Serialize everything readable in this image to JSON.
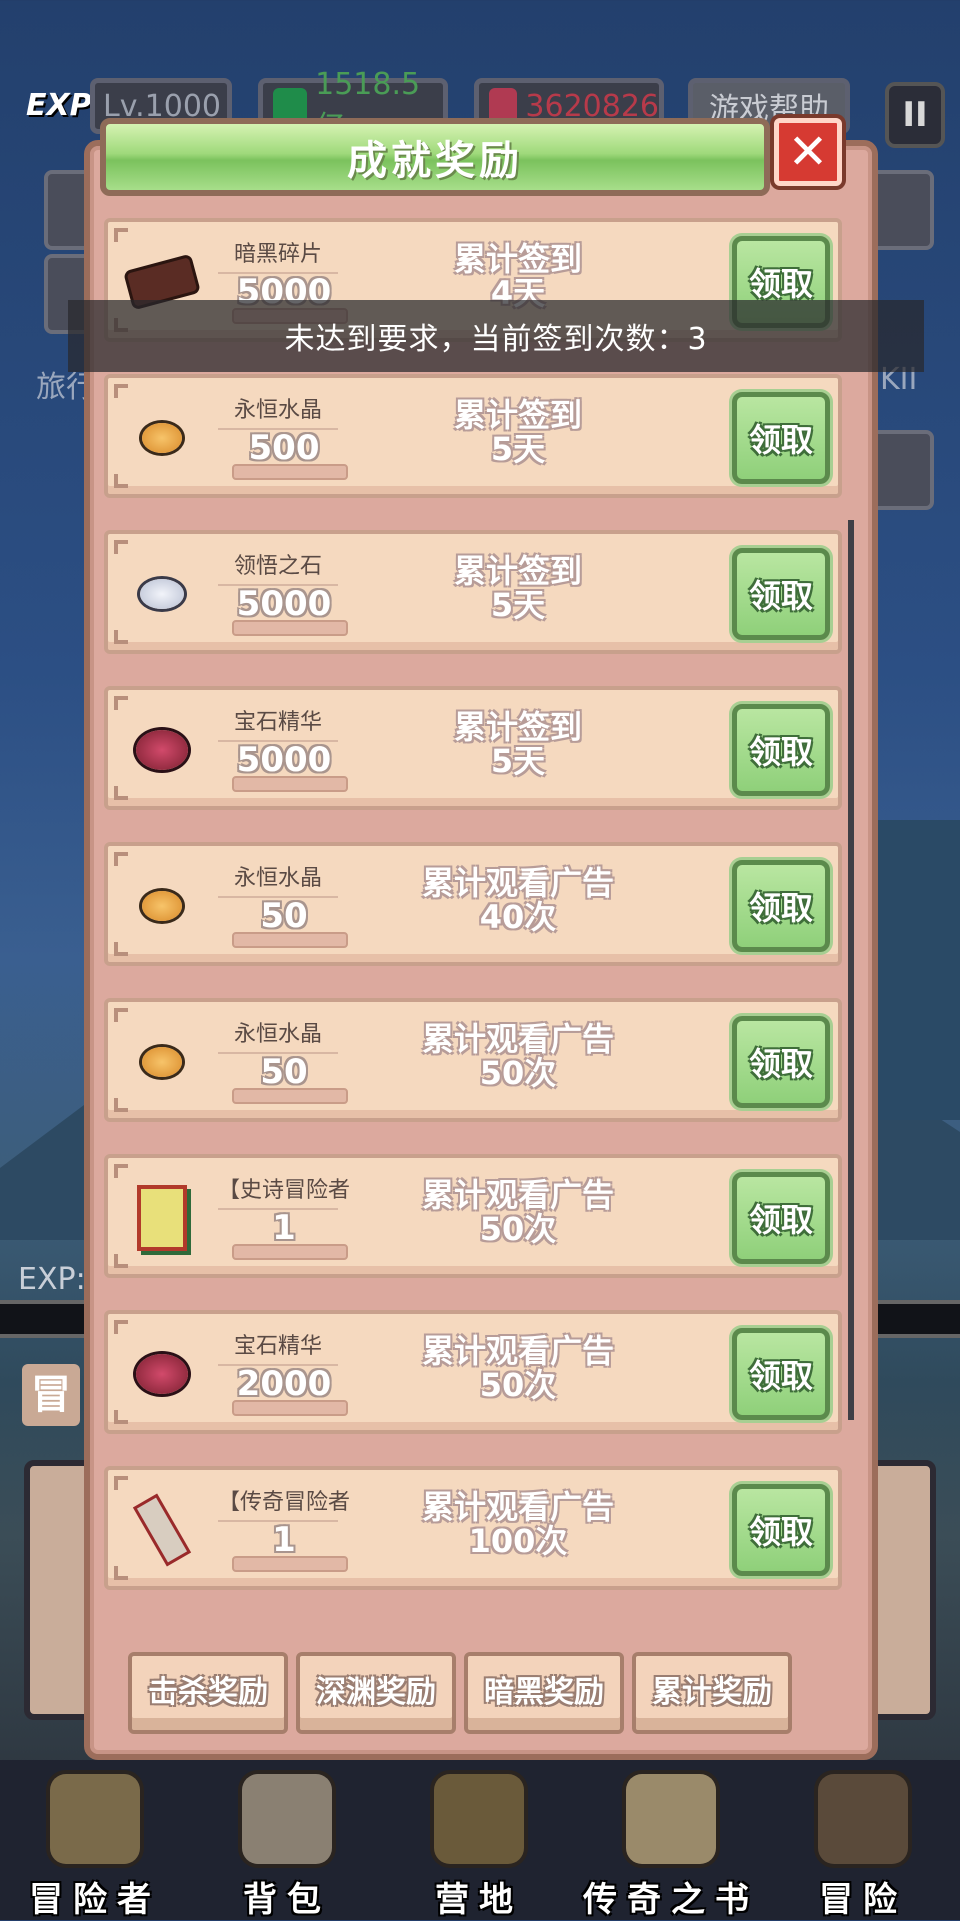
{
  "hud": {
    "exp_label": "EXP",
    "level": "Lv.1000",
    "green_currency": "1518.5亿",
    "red_currency": "3620826",
    "help_button": "游戏帮助",
    "pause": "II"
  },
  "background": {
    "side_text_left": "旅行",
    "side_text_right": "KII",
    "exp_bar_label": "EXP:",
    "left_tab_char": "冒"
  },
  "modal": {
    "title": "成就奖励",
    "close_label": "✕",
    "rows": [
      {
        "name": "暗黑碎片",
        "qty": "5000",
        "cond1": "累计签到",
        "cond2": "4天",
        "btn": "领取",
        "icon": "dark-shard-icon"
      },
      {
        "name": "永恒水晶",
        "qty": "500",
        "cond1": "累计签到",
        "cond2": "5天",
        "btn": "领取",
        "icon": "eternal-crystal-icon"
      },
      {
        "name": "领悟之石",
        "qty": "5000",
        "cond1": "累计签到",
        "cond2": "5天",
        "btn": "领取",
        "icon": "insight-stone-icon"
      },
      {
        "name": "宝石精华",
        "qty": "5000",
        "cond1": "累计签到",
        "cond2": "5天",
        "btn": "领取",
        "icon": "gem-essence-icon"
      },
      {
        "name": "永恒水晶",
        "qty": "50",
        "cond1": "累计观看广告",
        "cond2": "40次",
        "btn": "领取",
        "icon": "eternal-crystal-icon"
      },
      {
        "name": "永恒水晶",
        "qty": "50",
        "cond1": "累计观看广告",
        "cond2": "50次",
        "btn": "领取",
        "icon": "eternal-crystal-icon"
      },
      {
        "name": "【史诗冒险者",
        "qty": "1",
        "cond1": "累计观看广告",
        "cond2": "50次",
        "btn": "领取",
        "icon": "epic-adventurer-card-icon"
      },
      {
        "name": "宝石精华",
        "qty": "2000",
        "cond1": "累计观看广告",
        "cond2": "50次",
        "btn": "领取",
        "icon": "gem-essence-icon"
      },
      {
        "name": "【传奇冒险者",
        "qty": "1",
        "cond1": "累计观看广告",
        "cond2": "100次",
        "btn": "领取",
        "icon": "legend-scroll-icon"
      }
    ],
    "tabs": [
      "击杀奖励",
      "深渊奖励",
      "暗黑奖励",
      "累计奖励"
    ]
  },
  "toast": "未达到要求，当前签到次数：3",
  "bottom_nav": [
    {
      "label": "冒险者",
      "icon": "helmet-icon"
    },
    {
      "label": "背包",
      "icon": "backpack-icon"
    },
    {
      "label": "营地",
      "icon": "camp-banner-icon"
    },
    {
      "label": "传奇之书",
      "icon": "book-icon"
    },
    {
      "label": "冒险",
      "icon": "sword-icon"
    }
  ],
  "colors": {
    "accent_green": "#8fd07a",
    "panel": "#dca99e",
    "row": "#f5d9bf",
    "close_red": "#d63a32"
  }
}
